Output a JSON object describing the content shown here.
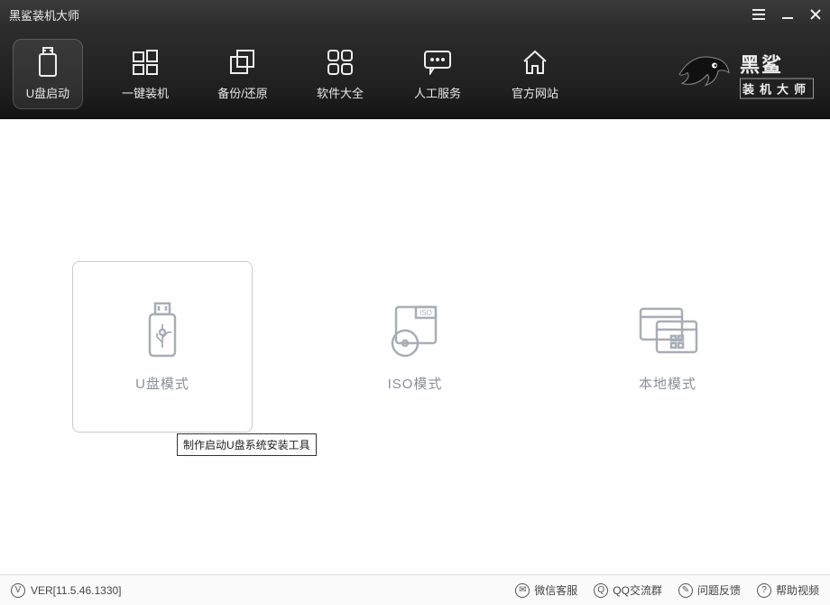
{
  "window": {
    "title": "黑鲨装机大师"
  },
  "nav": {
    "items": [
      {
        "label": "U盘启动",
        "icon": "usb-icon",
        "active": true
      },
      {
        "label": "一键装机",
        "icon": "windows-icon"
      },
      {
        "label": "备份/还原",
        "icon": "copy-icon"
      },
      {
        "label": "软件大全",
        "icon": "apps-icon"
      },
      {
        "label": "人工服务",
        "icon": "chat-icon"
      },
      {
        "label": "官方网站",
        "icon": "home-icon"
      }
    ]
  },
  "brand": {
    "line1": "黑鲨",
    "line2": "装机大师"
  },
  "modes": {
    "items": [
      {
        "label": "U盘模式",
        "icon": "usb-mode-icon",
        "active": true,
        "tooltip": "制作启动U盘系统安装工具"
      },
      {
        "label": "ISO模式",
        "icon": "iso-mode-icon"
      },
      {
        "label": "本地模式",
        "icon": "local-mode-icon"
      }
    ]
  },
  "status": {
    "version_label": "VER[11.5.46.1330]",
    "links": [
      {
        "label": "微信客服",
        "icon": "wechat-icon"
      },
      {
        "label": "QQ交流群",
        "icon": "qq-icon"
      },
      {
        "label": "问题反馈",
        "icon": "feedback-icon"
      },
      {
        "label": "帮助视频",
        "icon": "help-icon"
      }
    ]
  }
}
